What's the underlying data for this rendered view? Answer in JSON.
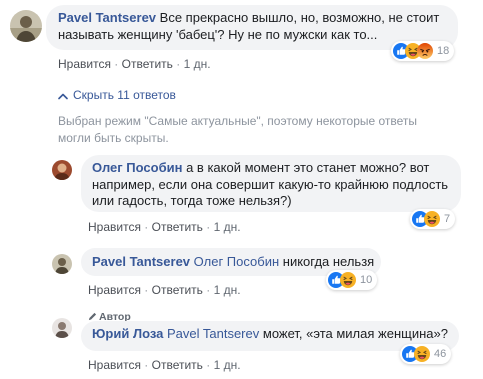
{
  "comments": [
    {
      "author": "Pavel Tantserev",
      "text_line1": "Все прекрасно вышло, но, возможно, не стоит",
      "text_line2": "называть женщину 'бабец'? Ну не по мужски как то...",
      "reactions": [
        "like",
        "haha",
        "angry"
      ],
      "reaction_count": "18",
      "like_label": "Нравится",
      "reply_label": "Ответить",
      "time": "1 дн."
    },
    {
      "author": "Олег Пособин",
      "text_line1_rest": "а в какой момент это станет можно? вот",
      "text_line2": "например, если она совершит какую-то крайнюю подлость",
      "text_line3": "или гадость, тогда тоже нельзя?)",
      "reactions": [
        "like",
        "haha"
      ],
      "reaction_count": "7",
      "like_label": "Нравится",
      "reply_label": "Ответить",
      "time": "1 дн."
    },
    {
      "author": "Pavel Tantserev",
      "mention": "Олег Пособин",
      "text": "никогда нельзя",
      "reactions": [
        "like",
        "haha"
      ],
      "reaction_count": "10",
      "like_label": "Нравится",
      "reply_label": "Ответить",
      "time": "1 дн."
    },
    {
      "badge": "Автор",
      "author": "Юрий Лоза",
      "mention": "Pavel Tantserev",
      "text": "может, «эта милая женщина»?",
      "reactions": [
        "like",
        "haha"
      ],
      "reaction_count": "46",
      "like_label": "Нравится",
      "reply_label": "Ответить",
      "time": "1 дн."
    }
  ],
  "hide_replies_label": "Скрыть 11 ответов",
  "filter_notice_line1": "Выбран режим \"Самые актуальные\", поэтому некоторые ответы",
  "filter_notice_line2": "могли быть скрыты.",
  "separator": "·",
  "colors": {
    "link": "#385898",
    "bubble": "#f2f3f5",
    "like": "#1877f2",
    "haha": "#f7b125",
    "angry": "#e9710f"
  }
}
